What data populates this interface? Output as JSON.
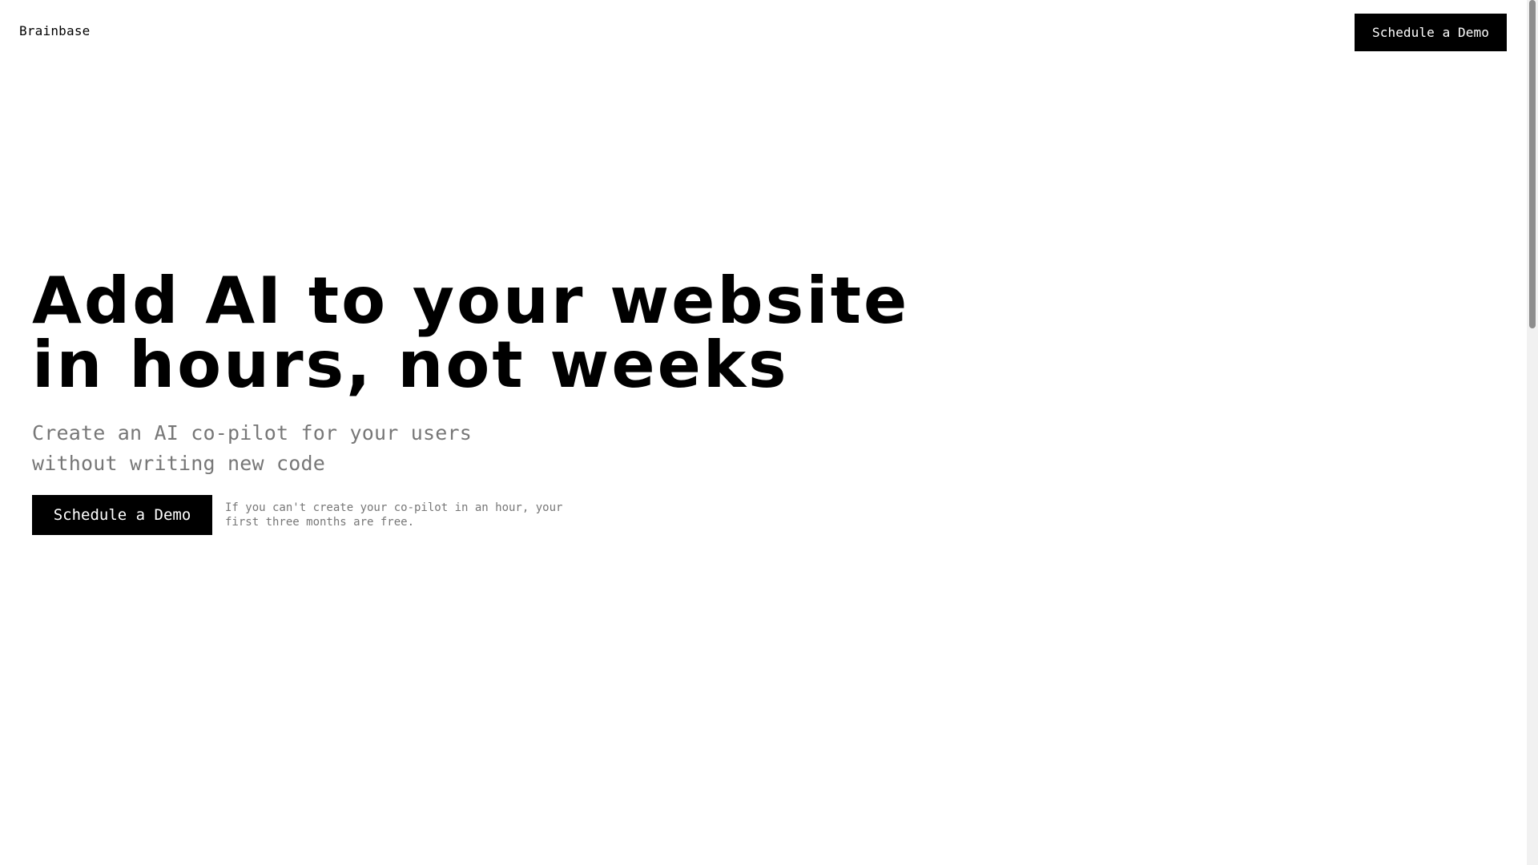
{
  "brand": {
    "name": "Brainbase"
  },
  "navigation": {
    "cta_label": "Schedule a Demo"
  },
  "hero": {
    "headline": "Add AI to your website in hours, not weeks",
    "subheadline": "Create an AI co-pilot for your users without writing new code",
    "cta_label": "Schedule a Demo",
    "guarantee_note": "If you can't create your co-pilot in an hour, your first three months are free."
  },
  "colors": {
    "primary": "#000000",
    "background": "#ffffff",
    "muted_text": "#777777"
  },
  "scrollbar": {
    "position_fraction": 0
  }
}
